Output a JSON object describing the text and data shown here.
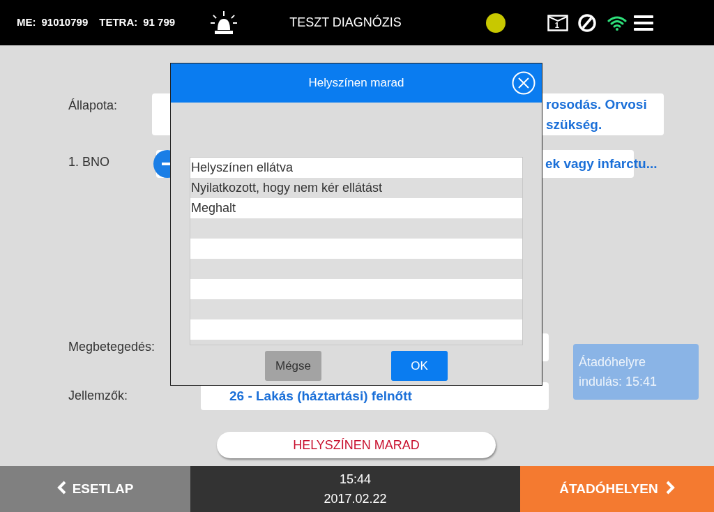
{
  "header": {
    "me_label": "ME:",
    "me_value": "91010799",
    "tetra_label": "TETRA:",
    "tetra_value": "91 799",
    "title": "TESZT DIAGNÓZIS",
    "mail_count": "1"
  },
  "fields": [
    {
      "label": "Állapota:",
      "value_lines": [
        "rosodás. Orvosi",
        "szükség."
      ]
    },
    {
      "label": "1. BNO",
      "value_lines": [
        "ek vagy infarctu..."
      ]
    },
    {
      "label": "Megbetegedés:"
    },
    {
      "label": "Jellemzők:",
      "value_lines": [
        "26 - Lakás (háztartási) felnőtt"
      ]
    }
  ],
  "departure_note": "Átadóhelyre indulás: 15:41",
  "stay_button": "HELYSZÍNEN MARAD",
  "dialog": {
    "title": "Helyszínen marad",
    "options": [
      {
        "label": "Helyszínen ellátva",
        "selected": false
      },
      {
        "label": "Nyilatkozott, hogy nem kér ellátást",
        "selected": false
      },
      {
        "label": "Meghalt",
        "selected": false
      }
    ],
    "cancel": "Mégse",
    "ok": "OK"
  },
  "footer": {
    "back": "ESETLAP",
    "time": "15:44",
    "date": "2017.02.22",
    "next": "ÁTADÓHELYEN"
  }
}
